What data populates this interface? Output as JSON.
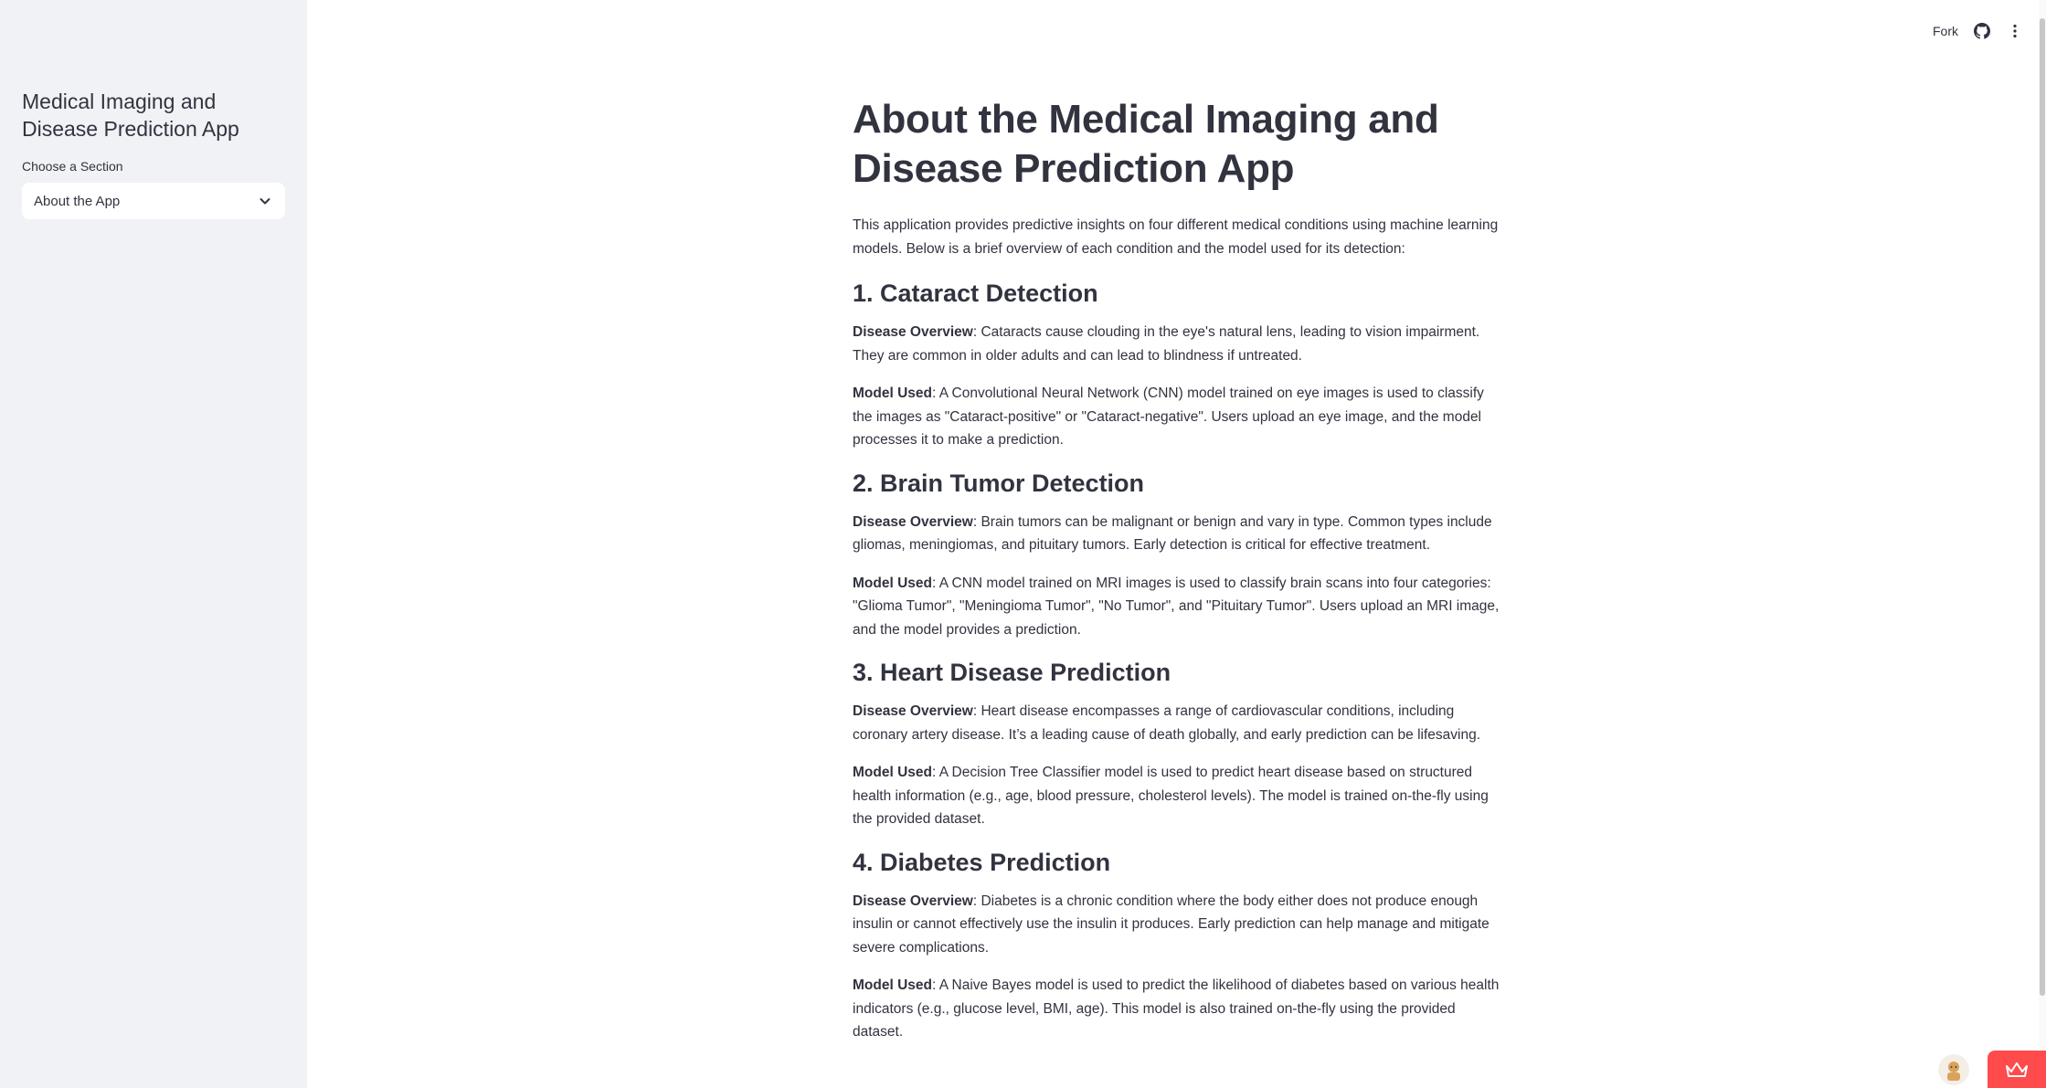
{
  "sidebar": {
    "title": "Medical Imaging and Disease Prediction App",
    "select_label": "Choose a Section",
    "select_value": "About the App"
  },
  "toolbar": {
    "fork_label": "Fork",
    "icons": [
      "github-icon",
      "more-vertical-icon"
    ]
  },
  "main": {
    "title": "About the Medical Imaging and Disease Prediction App",
    "intro": "This application provides predictive insights on four different medical conditions using machine learning models. Below is a brief overview of each condition and the model used for its detection:",
    "sections": [
      {
        "heading": "1. Cataract Detection",
        "overview_label": "Disease Overview",
        "overview_text": ": Cataracts cause clouding in the eye's natural lens, leading to vision impairment. They are common in older adults and can lead to blindness if untreated.",
        "model_label": "Model Used",
        "model_text": ": A Convolutional Neural Network (CNN) model trained on eye images is used to classify the images as \"Cataract-positive\" or \"Cataract-negative\". Users upload an eye image, and the model processes it to make a prediction."
      },
      {
        "heading": "2. Brain Tumor Detection",
        "overview_label": "Disease Overview",
        "overview_text": ": Brain tumors can be malignant or benign and vary in type. Common types include gliomas, meningiomas, and pituitary tumors. Early detection is critical for effective treatment.",
        "model_label": "Model Used",
        "model_text": ": A CNN model trained on MRI images is used to classify brain scans into four categories: \"Glioma Tumor\", \"Meningioma Tumor\", \"No Tumor\", and \"Pituitary Tumor\". Users upload an MRI image, and the model provides a prediction."
      },
      {
        "heading": "3. Heart Disease Prediction",
        "overview_label": "Disease Overview",
        "overview_text": ": Heart disease encompasses a range of cardiovascular conditions, including coronary artery disease. It’s a leading cause of death globally, and early prediction can be lifesaving.",
        "model_label": "Model Used",
        "model_text": ": A Decision Tree Classifier model is used to predict heart disease based on structured health information (e.g., age, blood pressure, cholesterol levels). The model is trained on-the-fly using the provided dataset."
      },
      {
        "heading": "4. Diabetes Prediction",
        "overview_label": "Disease Overview",
        "overview_text": ": Diabetes is a chronic condition where the body either does not produce enough insulin or cannot effectively use the insulin it produces. Early prediction can help manage and mitigate severe complications.",
        "model_label": "Model Used",
        "model_text": ": A Naive Bayes model is used to predict the likelihood of diabetes based on various health indicators (e.g., glucose level, BMI, age). This model is also trained on-the-fly using the provided dataset."
      }
    ]
  },
  "colors": {
    "sidebar_bg": "#f0f2f6",
    "text": "#31333f",
    "accent": "#ff4b4b"
  }
}
